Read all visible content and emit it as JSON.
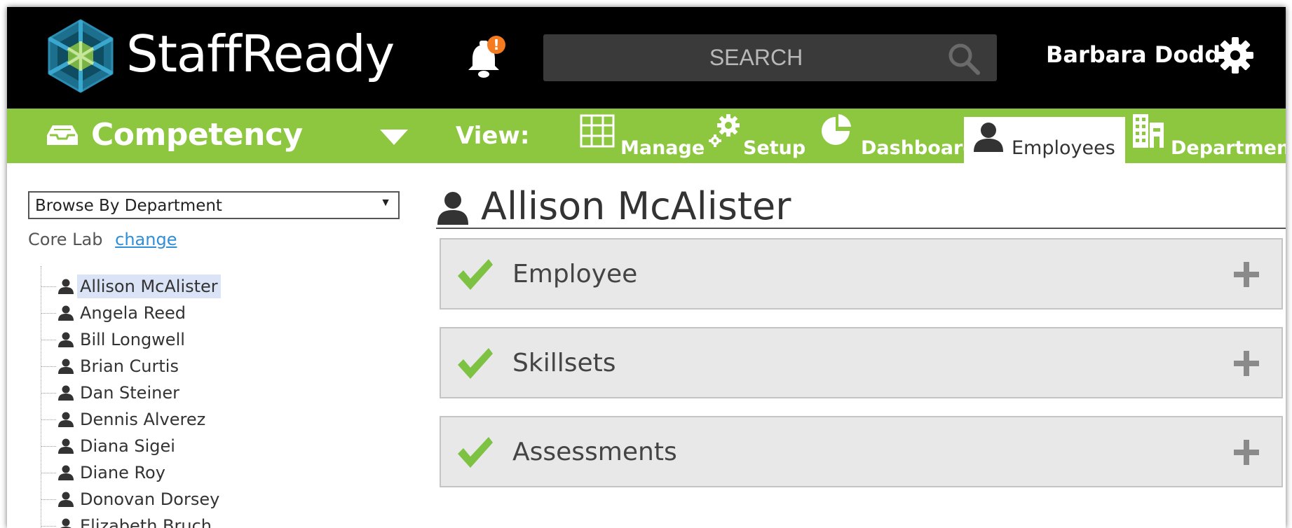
{
  "brand": {
    "name": "StaffReady"
  },
  "notifications": {
    "badge": "!"
  },
  "search": {
    "placeholder": "SEARCH"
  },
  "user": {
    "name": "Barbara Dodd"
  },
  "module": {
    "name": "Competency"
  },
  "view": {
    "label": "View:",
    "tabs": [
      {
        "label": "Manage",
        "icon": "grid-icon"
      },
      {
        "label": "Setup",
        "icon": "gears-icon"
      },
      {
        "label": "Dashboard",
        "icon": "pie-chart-icon"
      },
      {
        "label": "Employees",
        "icon": "person-icon",
        "active": true
      },
      {
        "label": "Departments",
        "icon": "building-icon"
      }
    ]
  },
  "sidebar": {
    "browse_select": "Browse By Department",
    "department": "Core Lab",
    "change_link": "change",
    "employees": [
      {
        "name": "Allison McAlister",
        "selected": true
      },
      {
        "name": "Angela Reed"
      },
      {
        "name": "Bill Longwell"
      },
      {
        "name": "Brian Curtis"
      },
      {
        "name": "Dan Steiner"
      },
      {
        "name": "Dennis Alverez"
      },
      {
        "name": "Diana Sigei"
      },
      {
        "name": "Diane Roy"
      },
      {
        "name": "Donovan Dorsey"
      },
      {
        "name": "Elizabeth Bruch"
      }
    ]
  },
  "main": {
    "title": "Allison McAlister",
    "sections": [
      {
        "title": "Employee",
        "status": "complete"
      },
      {
        "title": "Skillsets",
        "status": "complete"
      },
      {
        "title": "Assessments",
        "status": "complete"
      }
    ]
  },
  "colors": {
    "topbar": "#000000",
    "navbar": "#8dc63f",
    "check": "#7dc242",
    "link": "#2f8fd8",
    "selected_row": "#dbe4f6"
  }
}
